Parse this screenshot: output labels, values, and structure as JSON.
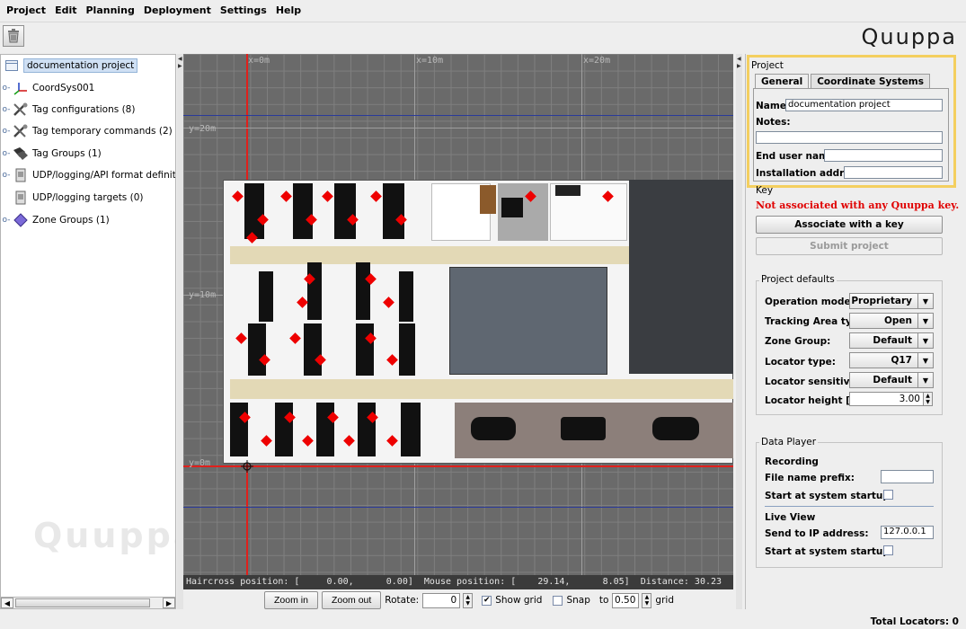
{
  "menu": {
    "items": [
      {
        "label": "Project",
        "mnemonic": "P"
      },
      {
        "label": "Edit",
        "mnemonic": "E"
      },
      {
        "label": "Planning",
        "mnemonic": "l"
      },
      {
        "label": "Deployment",
        "mnemonic": "D"
      },
      {
        "label": "Settings",
        "mnemonic": "S"
      },
      {
        "label": "Help",
        "mnemonic": "H"
      }
    ]
  },
  "toolbar": {
    "brand": "Quuppa",
    "trash_icon": "trash-icon"
  },
  "tree": {
    "root": "documentation project",
    "items": [
      {
        "label": "CoordSys001",
        "icon": "axis-icon"
      },
      {
        "label": "Tag configurations (8)",
        "icon": "tools-icon"
      },
      {
        "label": "Tag temporary commands (2)",
        "icon": "tools-icon"
      },
      {
        "label": "Tag Groups (1)",
        "icon": "tags-icon"
      },
      {
        "label": "UDP/logging/API format definitions (",
        "icon": "document-icon"
      },
      {
        "label": "UDP/logging targets (0)",
        "icon": "document-icon"
      },
      {
        "label": "Zone Groups (1)",
        "icon": "zone-icon"
      }
    ],
    "watermark": "Quuppa"
  },
  "map": {
    "x_labels": [
      "x=0m",
      "x=10m",
      "x=20m"
    ],
    "y_labels": [
      "y=20m",
      "y=10m",
      "y=0m"
    ],
    "status": "Haircross position: [     0.00,      0.00]  Mouse position: [    29.14,      8.05]  Distance: 30.23",
    "controls": {
      "zoom_in": "Zoom in",
      "zoom_out": "Zoom out",
      "rotate_label": "Rotate:",
      "rotate_value": "0",
      "show_grid_label": "Show grid",
      "show_grid_checked": true,
      "snap_label": "Snap",
      "snap_checked": false,
      "to_label": "to",
      "snap_value": "0.50",
      "grid_label": "grid"
    },
    "colors": {
      "background": "#6a6a6a",
      "origin_axis": "#e0201c",
      "boundary": "#2a3a9a"
    }
  },
  "project_panel": {
    "title": "Project",
    "tabs": [
      "General",
      "Coordinate Systems"
    ],
    "active_tab": "General",
    "name_label": "Name:",
    "name_value": "documentation project",
    "notes_label": "Notes:",
    "notes_value": "",
    "end_user_label": "End user name:",
    "end_user_value": "",
    "install_label": "Installation address:",
    "install_value": "",
    "key_title": "Key",
    "key_warning": "Not associated with any Quuppa key.",
    "associate_btn": "Associate with a key",
    "submit_btn": "Submit project",
    "defaults": {
      "title": "Project defaults",
      "rows": [
        {
          "label": "Operation mode:",
          "value": "Proprietary"
        },
        {
          "label": "Tracking Area type:",
          "value": "Open"
        },
        {
          "label": "Zone Group:",
          "value": "Default"
        },
        {
          "label": "Locator type:",
          "value": "Q17"
        },
        {
          "label": "Locator sensitivity:",
          "value": "Default"
        }
      ],
      "height_label": "Locator height  [m]:",
      "height_value": "3.00"
    },
    "data_player": {
      "title": "Data Player",
      "recording_title": "Recording",
      "prefix_label": "File name prefix:",
      "prefix_value": "",
      "rec_startup_label": "Start at system startup:",
      "rec_startup_checked": false,
      "live_title": "Live View",
      "ip_label": "Send to IP address:",
      "ip_value": "127.0.0.1",
      "live_startup_label": "Start at system startup:",
      "live_startup_checked": false
    }
  },
  "status_bar": {
    "total_locators": "Total Locators: 0"
  }
}
